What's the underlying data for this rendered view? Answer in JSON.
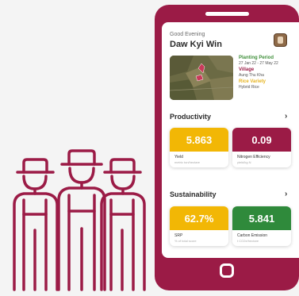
{
  "app": {
    "greeting": "Good Evening",
    "user_name": "Daw Kyi Win",
    "info": {
      "planting_label": "Planting Period",
      "planting_value": "27 Jan 22 - 27 May 22",
      "village_label": "Village",
      "village_value": "Aung Thu Kha",
      "rice_label": "Rice Variety",
      "rice_value": "Hybrid Rice"
    },
    "productivity": {
      "title": "Productivity",
      "chevron": "›",
      "cards": [
        {
          "value": "5.863",
          "label": "Yield",
          "sub": "metric ton/hectare"
        },
        {
          "value": "0.09",
          "label": "Nitrogen Efficiency",
          "sub": "yield/kg N"
        }
      ]
    },
    "sustainability": {
      "title": "Sustainability",
      "chevron": "›",
      "cards": [
        {
          "value": "62.7%",
          "label": "SRP",
          "sub": "% of total score"
        },
        {
          "value": "5.841",
          "label": "Carbon Emission",
          "sub": "t CO2e/hectare"
        }
      ]
    }
  },
  "colors": {
    "brand": "#9b1b46",
    "yellow": "#f2b705",
    "green": "#2f8a3b"
  },
  "icons": {
    "farmers": "farmers-group-illustration",
    "avatar": "user-avatar",
    "chevron": "chevron-right-icon"
  }
}
